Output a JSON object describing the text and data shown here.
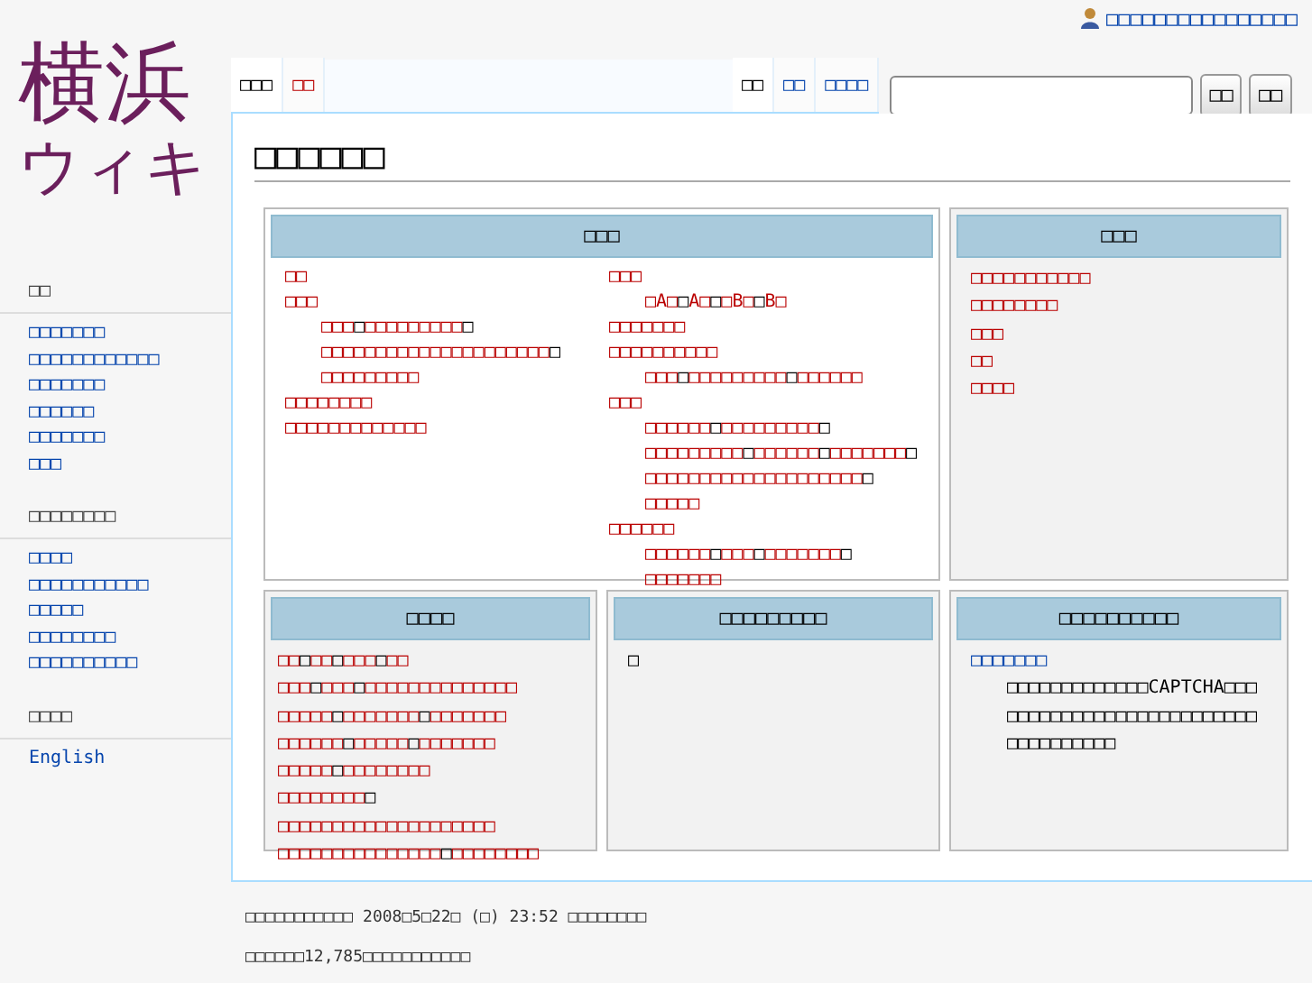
{
  "personal_link": "□□□□□□□□□□□□□□□□",
  "logo": {
    "line_1": "横浜",
    "line_2": "ウィキ"
  },
  "tabs_left": [
    {
      "label": "□□□",
      "selected": true
    },
    {
      "label": "□□",
      "selected": false,
      "exists": false
    }
  ],
  "tabs_right": [
    {
      "label": "□□",
      "selected": true
    },
    {
      "label": "□□",
      "selected": false,
      "exists": true
    },
    {
      "label": "□□□□",
      "selected": false,
      "exists": true
    }
  ],
  "search": {
    "buttons": [
      "□□",
      "□□"
    ]
  },
  "page_title": "□□□□□□",
  "sidebar": [
    {
      "heading": "□□",
      "items": [
        "□□□□□□□",
        "□□□□□□□□□□□□",
        "□□□□□□□",
        "□□□□□□",
        "□□□□□□□",
        "□□□"
      ]
    },
    {
      "heading": "□□□□□□□□",
      "items": [
        "□□□□",
        "□□□□□□□□□□□",
        "□□□□□",
        "□□□□□□□□",
        "□□□□□□□□□□"
      ]
    },
    {
      "heading": "□□□□",
      "items": [
        "English"
      ]
    }
  ],
  "boxes": [
    {
      "title": "□□□",
      "shaded": false,
      "columns": [
        [
          {
            "text": "□□"
          },
          {
            "text": "□□□",
            "children": [
              [
                {
                  "t": "□□□",
                  "link": true
                },
                {
                  "t": "□",
                  "link": false
                },
                {
                  "t": "□□□□□□□□□",
                  "link": true
                },
                {
                  "t": "□",
                  "link": false
                },
                {
                  "t": "□□□□□□□□□□□□□□□",
                  "link": true
                },
                {
                  "t": "□□□□□□",
                  "link": true
                },
                {
                  "t": "□",
                  "link": false
                },
                {
                  "t": "□□□□□□□□□",
                  "link": true
                }
              ]
            ]
          },
          {
            "text": "□□□□□□□□"
          },
          {
            "text": "□□□□□□□□□□□□□"
          }
        ],
        [
          {
            "text": "□□□",
            "children": [
              [
                {
                  "t": "□A□",
                  "link": true
                },
                {
                  "t": "□",
                  "link": false
                },
                {
                  "t": "A□",
                  "link": true
                },
                {
                  "t": "□",
                  "link": false
                },
                {
                  "t": "□B□",
                  "link": true
                },
                {
                  "t": "□",
                  "link": false
                },
                {
                  "t": "B□",
                  "link": true
                }
              ]
            ]
          },
          {
            "text": "□□□□□□□"
          },
          {
            "text": "□□□□□□□□□□",
            "children": [
              [
                {
                  "t": "□□□",
                  "link": true
                },
                {
                  "t": "□",
                  "link": false
                },
                {
                  "t": "□□□□□□□□□",
                  "link": true
                },
                {
                  "t": "□",
                  "link": false
                },
                {
                  "t": "□□□□□□",
                  "link": true
                }
              ]
            ]
          },
          {
            "text": "□□□",
            "children": [
              [
                {
                  "t": "□□□□□□",
                  "link": true
                },
                {
                  "t": "□",
                  "link": false
                },
                {
                  "t": "□□□□□□□□□",
                  "link": true
                },
                {
                  "t": "□",
                  "link": false
                },
                {
                  "t": "□□□□□□□□□",
                  "link": true
                },
                {
                  "t": "□",
                  "link": false
                },
                {
                  "t": "□□□",
                  "link": true
                },
                {
                  "t": "□□□",
                  "link": true
                },
                {
                  "t": "□",
                  "link": false
                },
                {
                  "t": "□□□□□□□",
                  "link": true
                },
                {
                  "t": "□",
                  "link": false
                },
                {
                  "t": "□□□□□□□□□□□□□□□",
                  "link": true
                },
                {
                  "t": "□□□□□",
                  "link": true
                },
                {
                  "t": "□",
                  "link": false
                },
                {
                  "t": "□□□□□",
                  "link": true
                }
              ]
            ]
          },
          {
            "text": "□□□□□□",
            "children": [
              [
                {
                  "t": "□□□□□□",
                  "link": true
                },
                {
                  "t": "□",
                  "link": false
                },
                {
                  "t": "□□□",
                  "link": true
                },
                {
                  "t": "□",
                  "link": false
                },
                {
                  "t": "□□□□□□□",
                  "link": true
                },
                {
                  "t": "□",
                  "link": false
                },
                {
                  "t": "□□□□□□□",
                  "link": true
                }
              ]
            ]
          }
        ]
      ]
    },
    {
      "title": "□□□",
      "shaded": true,
      "columns": [
        [
          {
            "text": "□□□□□□□□□□□"
          },
          {
            "text": "□□□□□□□□"
          },
          {
            "text": "□□□"
          },
          {
            "text": "□□"
          },
          {
            "text": "□□□□"
          }
        ]
      ]
    },
    {
      "title": "□□□□",
      "shaded": true,
      "lines": [
        [
          {
            "t": "□□",
            "link": true
          },
          {
            "t": "□",
            "link": false
          },
          {
            "t": "□□",
            "link": true
          },
          {
            "t": "□",
            "link": false
          },
          {
            "t": "□□□",
            "link": true
          },
          {
            "t": "□",
            "link": false
          },
          {
            "t": "□□",
            "link": true
          }
        ],
        [
          {
            "t": "□□□",
            "link": true
          },
          {
            "t": "□",
            "link": false
          },
          {
            "t": "□□□",
            "link": true
          },
          {
            "t": "□",
            "link": false
          },
          {
            "t": "□□□□□□□□□□□□□□",
            "link": true
          }
        ],
        [
          {
            "t": "□□□□□",
            "link": true
          },
          {
            "t": "□",
            "link": false
          },
          {
            "t": "□□□□□□□",
            "link": true
          },
          {
            "t": "□",
            "link": false
          },
          {
            "t": "□□□□□□□",
            "link": true
          }
        ],
        [
          {
            "t": "□□□□□□",
            "link": true
          },
          {
            "t": "□",
            "link": false
          },
          {
            "t": "□□□□□",
            "link": true
          },
          {
            "t": "□",
            "link": false
          },
          {
            "t": "□□□□□□□",
            "link": true
          }
        ],
        [
          {
            "t": "□□□□□",
            "link": true
          },
          {
            "t": "□",
            "link": false
          },
          {
            "t": "□□□□□□□□",
            "link": true
          }
        ],
        [
          {
            "t": "□□□□□□□□",
            "link": true
          },
          {
            "t": "□",
            "link": false
          },
          {
            "t": "□□□□□□□□□□□□□□□□□□□□",
            "link": true
          }
        ],
        [
          {
            "t": "□□□□□□□□□□□□□□□",
            "link": true
          },
          {
            "t": "□",
            "link": false
          },
          {
            "t": "□□□□□□□□",
            "link": true
          }
        ]
      ]
    },
    {
      "title": "□□□□□□□□□",
      "shaded": true,
      "text": "□"
    },
    {
      "title": "□□□□□□□□□□",
      "shaded": true,
      "link": "□□□□□□□",
      "text": "□□□□□□□□□□□□□CAPTCHA□□□□□□□□□□□□□□□□□□□□□□□□□□□□□□□□□□□□"
    }
  ],
  "footer": [
    "□□□□□□□□□□□ 2008□5□22□ (□) 23:52 □□□□□□□□",
    "□□□□□□12,785□□□□□□□□□□□"
  ]
}
